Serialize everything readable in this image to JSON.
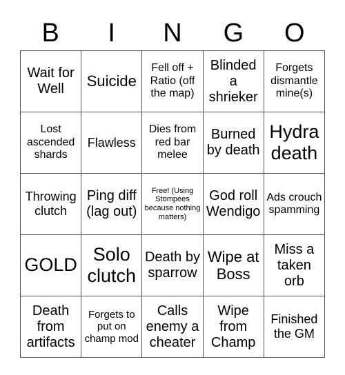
{
  "header": [
    "B",
    "I",
    "N",
    "G",
    "O"
  ],
  "rows": [
    [
      "Wait for Well",
      "Suicide",
      "Fell off + Ratio (off the map)",
      "Blinded a shrieker",
      "Forgets dismantle mine(s)"
    ],
    [
      "Lost ascended shards",
      "Flawless",
      "Dies from red bar melee",
      "Burned by death",
      "Hydra death"
    ],
    [
      "Throwing clutch",
      "Ping diff (lag out)",
      "Free! (Using Stompees because nothing matters)",
      "God roll Wendigo",
      "Ads crouch spamming"
    ],
    [
      "GOLD",
      "Solo clutch",
      "Death by sparrow",
      "Wipe at Boss",
      "Miss a taken orb"
    ],
    [
      "Death from artifacts",
      "Forgets to put on champ mod",
      "Calls enemy a cheater",
      "Wipe from Champ",
      "Finished the GM"
    ]
  ]
}
